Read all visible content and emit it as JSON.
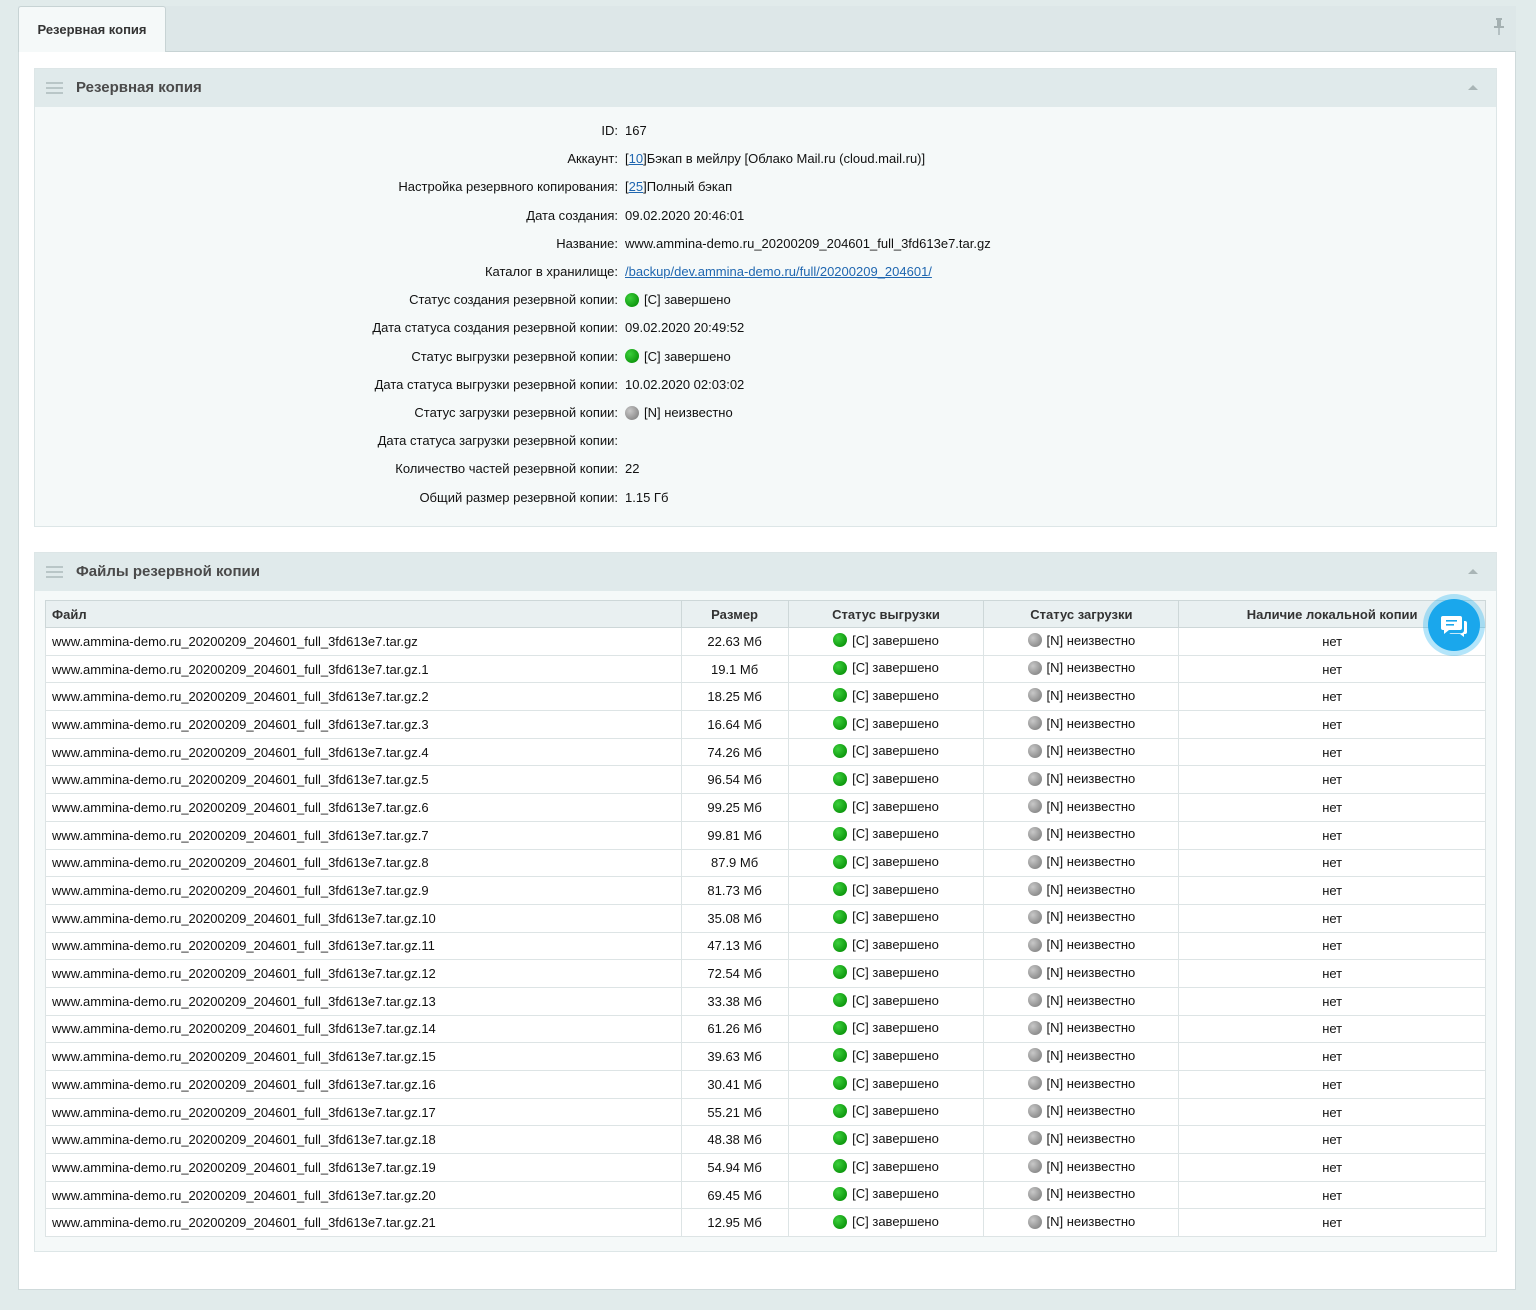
{
  "tab": {
    "label": "Резервная копия"
  },
  "details_panel": {
    "title": "Резервная копия",
    "fields": [
      {
        "label": "ID:",
        "value": "167"
      },
      {
        "label": "Аккаунт:",
        "link": "10",
        "value": "Бэкап в мейлру [Облако Mail.ru (cloud.mail.ru)]"
      },
      {
        "label": "Настройка резервного копирования:",
        "link": "25",
        "value": "Полный бэкап"
      },
      {
        "label": "Дата создания:",
        "value": "09.02.2020 20:46:01"
      },
      {
        "label": "Название:",
        "value": "www.ammina-demo.ru_20200209_204601_full_3fd613e7.tar.gz"
      },
      {
        "label": "Каталог в хранилище:",
        "url_text": "/backup/dev.ammina-demo.ru/full/20200209_204601/"
      },
      {
        "label": "Статус создания резервной копии:",
        "status": "green",
        "value": "[C] завершено"
      },
      {
        "label": "Дата статуса создания резервной копии:",
        "value": "09.02.2020 20:49:52"
      },
      {
        "label": "Статус выгрузки резервной копии:",
        "status": "green",
        "value": "[C] завершено"
      },
      {
        "label": "Дата статуса выгрузки резервной копии:",
        "value": "10.02.2020 02:03:02"
      },
      {
        "label": "Статус загрузки резервной копии:",
        "status": "gray",
        "value": "[N] неизвестно"
      },
      {
        "label": "Дата статуса загрузки резервной копии:",
        "value": ""
      },
      {
        "label": "Количество частей резервной копии:",
        "value": "22"
      },
      {
        "label": "Общий размер резервной копии:",
        "value": "1.15 Гб"
      }
    ]
  },
  "files_panel": {
    "title": "Файлы резервной копии",
    "columns": [
      "Файл",
      "Размер",
      "Статус выгрузки",
      "Статус загрузки",
      "Наличие локальной копии"
    ],
    "rows": [
      [
        "www.ammina-demo.ru_20200209_204601_full_3fd613e7.tar.gz",
        "22.63 Мб",
        "[C] завершено",
        "[N] неизвестно",
        "нет"
      ],
      [
        "www.ammina-demo.ru_20200209_204601_full_3fd613e7.tar.gz.1",
        "19.1 Мб",
        "[C] завершено",
        "[N] неизвестно",
        "нет"
      ],
      [
        "www.ammina-demo.ru_20200209_204601_full_3fd613e7.tar.gz.2",
        "18.25 Мб",
        "[C] завершено",
        "[N] неизвестно",
        "нет"
      ],
      [
        "www.ammina-demo.ru_20200209_204601_full_3fd613e7.tar.gz.3",
        "16.64 Мб",
        "[C] завершено",
        "[N] неизвестно",
        "нет"
      ],
      [
        "www.ammina-demo.ru_20200209_204601_full_3fd613e7.tar.gz.4",
        "74.26 Мб",
        "[C] завершено",
        "[N] неизвестно",
        "нет"
      ],
      [
        "www.ammina-demo.ru_20200209_204601_full_3fd613e7.tar.gz.5",
        "96.54 Мб",
        "[C] завершено",
        "[N] неизвестно",
        "нет"
      ],
      [
        "www.ammina-demo.ru_20200209_204601_full_3fd613e7.tar.gz.6",
        "99.25 Мб",
        "[C] завершено",
        "[N] неизвестно",
        "нет"
      ],
      [
        "www.ammina-demo.ru_20200209_204601_full_3fd613e7.tar.gz.7",
        "99.81 Мб",
        "[C] завершено",
        "[N] неизвестно",
        "нет"
      ],
      [
        "www.ammina-demo.ru_20200209_204601_full_3fd613e7.tar.gz.8",
        "87.9 Мб",
        "[C] завершено",
        "[N] неизвестно",
        "нет"
      ],
      [
        "www.ammina-demo.ru_20200209_204601_full_3fd613e7.tar.gz.9",
        "81.73 Мб",
        "[C] завершено",
        "[N] неизвестно",
        "нет"
      ],
      [
        "www.ammina-demo.ru_20200209_204601_full_3fd613e7.tar.gz.10",
        "35.08 Мб",
        "[C] завершено",
        "[N] неизвестно",
        "нет"
      ],
      [
        "www.ammina-demo.ru_20200209_204601_full_3fd613e7.tar.gz.11",
        "47.13 Мб",
        "[C] завершено",
        "[N] неизвестно",
        "нет"
      ],
      [
        "www.ammina-demo.ru_20200209_204601_full_3fd613e7.tar.gz.12",
        "72.54 Мб",
        "[C] завершено",
        "[N] неизвестно",
        "нет"
      ],
      [
        "www.ammina-demo.ru_20200209_204601_full_3fd613e7.tar.gz.13",
        "33.38 Мб",
        "[C] завершено",
        "[N] неизвестно",
        "нет"
      ],
      [
        "www.ammina-demo.ru_20200209_204601_full_3fd613e7.tar.gz.14",
        "61.26 Мб",
        "[C] завершено",
        "[N] неизвестно",
        "нет"
      ],
      [
        "www.ammina-demo.ru_20200209_204601_full_3fd613e7.tar.gz.15",
        "39.63 Мб",
        "[C] завершено",
        "[N] неизвестно",
        "нет"
      ],
      [
        "www.ammina-demo.ru_20200209_204601_full_3fd613e7.tar.gz.16",
        "30.41 Мб",
        "[C] завершено",
        "[N] неизвестно",
        "нет"
      ],
      [
        "www.ammina-demo.ru_20200209_204601_full_3fd613e7.tar.gz.17",
        "55.21 Мб",
        "[C] завершено",
        "[N] неизвестно",
        "нет"
      ],
      [
        "www.ammina-demo.ru_20200209_204601_full_3fd613e7.tar.gz.18",
        "48.38 Мб",
        "[C] завершено",
        "[N] неизвестно",
        "нет"
      ],
      [
        "www.ammina-demo.ru_20200209_204601_full_3fd613e7.tar.gz.19",
        "54.94 Мб",
        "[C] завершено",
        "[N] неизвестно",
        "нет"
      ],
      [
        "www.ammina-demo.ru_20200209_204601_full_3fd613e7.tar.gz.20",
        "69.45 Мб",
        "[C] завершено",
        "[N] неизвестно",
        "нет"
      ],
      [
        "www.ammina-demo.ru_20200209_204601_full_3fd613e7.tar.gz.21",
        "12.95 Мб",
        "[C] завершено",
        "[N] неизвестно",
        "нет"
      ]
    ]
  },
  "colors": {
    "status_green": "#109a10",
    "status_gray": "#8e8e8e",
    "chat_button": "#1aa7ec",
    "link": "#2067b0"
  },
  "icons": {
    "pin": "pin-icon",
    "menu": "drag-menu-icon",
    "collapse": "collapse-arrow-icon",
    "chat": "chat-icon"
  }
}
